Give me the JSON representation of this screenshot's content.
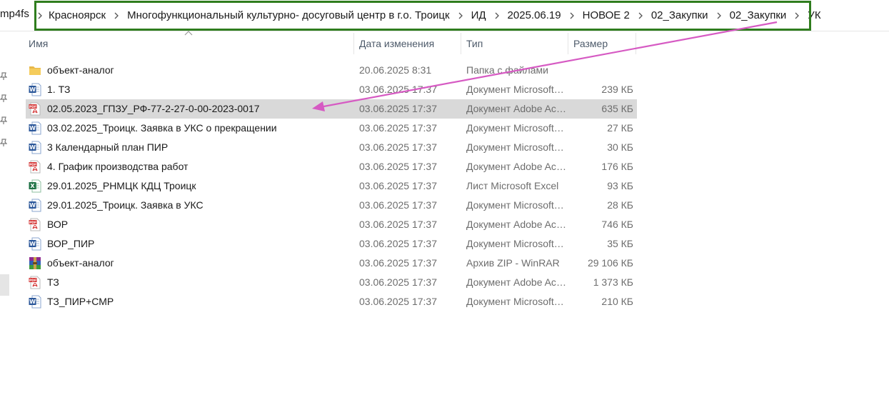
{
  "breadcrumb": {
    "lead": "mp4fs",
    "items": [
      "Красноярск",
      "Многофункциональный культурно- досуговый центр в г.о. Троицк",
      "ИД",
      "2025.06.19",
      "НОВОЕ 2",
      "02_Закупки",
      "02_Закупки",
      "УК"
    ]
  },
  "columns": {
    "name": "Имя",
    "date": "Дата изменения",
    "type": "Тип",
    "size": "Размер"
  },
  "files": [
    {
      "name": "объект-аналог",
      "date": "20.06.2025 8:31",
      "type": "Папка с файлами",
      "size": "",
      "icon": "folder-icon"
    },
    {
      "name": "1. ТЗ",
      "date": "03.06.2025 17:37",
      "type": "Документ Microsoft Word",
      "size": "239 КБ",
      "icon": "word-document-icon"
    },
    {
      "name": "02.05.2023_ГПЗУ_РФ-77-2-27-0-00-2023-0017",
      "date": "03.06.2025 17:37",
      "type": "Документ Adobe Acrobat",
      "size": "635 КБ",
      "icon": "pdf-document-icon",
      "selected": true
    },
    {
      "name": "03.02.2025_Троицк. Заявка в УКС о прекращении",
      "date": "03.06.2025 17:37",
      "type": "Документ Microsoft Word",
      "size": "27 КБ",
      "icon": "word-document-icon"
    },
    {
      "name": "3 Календарный план ПИР",
      "date": "03.06.2025 17:37",
      "type": "Документ Microsoft Word",
      "size": "30 КБ",
      "icon": "word-document-icon"
    },
    {
      "name": "4. График производства работ",
      "date": "03.06.2025 17:37",
      "type": "Документ Adobe Acrobat",
      "size": "176 КБ",
      "icon": "pdf-document-icon"
    },
    {
      "name": "29.01.2025_РНМЦК КДЦ Троицк",
      "date": "03.06.2025 17:37",
      "type": "Лист Microsoft Excel",
      "size": "93 КБ",
      "icon": "excel-sheet-icon"
    },
    {
      "name": "29.01.2025_Троицк. Заявка в УКС",
      "date": "03.06.2025 17:37",
      "type": "Документ Microsoft Word",
      "size": "28 КБ",
      "icon": "word-document-icon"
    },
    {
      "name": "ВОР",
      "date": "03.06.2025 17:37",
      "type": "Документ Adobe Acrobat",
      "size": "746 КБ",
      "icon": "pdf-document-icon"
    },
    {
      "name": "ВОР_ПИР",
      "date": "03.06.2025 17:37",
      "type": "Документ Microsoft Word",
      "size": "35 КБ",
      "icon": "word-document-icon"
    },
    {
      "name": "объект-аналог",
      "date": "03.06.2025 17:37",
      "type": "Архив ZIP - WinRAR",
      "size": "29 106 КБ",
      "icon": "winrar-archive-icon"
    },
    {
      "name": "ТЗ",
      "date": "03.06.2025 17:37",
      "type": "Документ Adobe Acrobat",
      "size": "1 373 КБ",
      "icon": "pdf-document-icon"
    },
    {
      "name": "ТЗ_ПИР+СМР",
      "date": "03.06.2025 17:37",
      "type": "Документ Microsoft Word",
      "size": "210 КБ",
      "icon": "word-document-icon"
    }
  ],
  "colors": {
    "highlight_box": "#2f7d1e",
    "annotation_arrow": "#d65ac3",
    "selection": "#d9d9d9",
    "word": "#2b579a",
    "pdf": "#d32f2f",
    "excel": "#1e7145",
    "folder": "#e8b84a"
  }
}
